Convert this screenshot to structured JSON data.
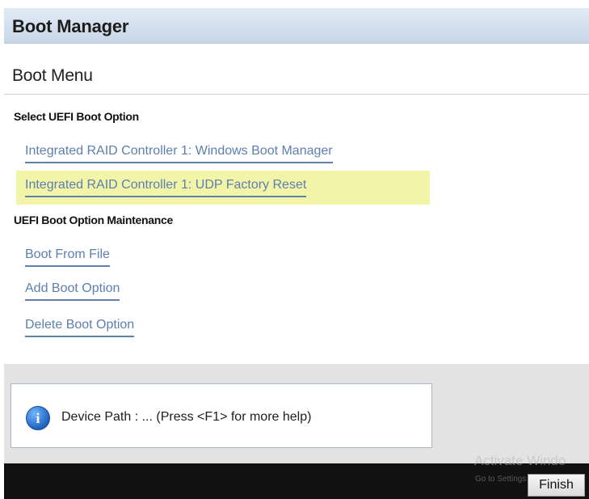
{
  "title": "Boot Manager",
  "boot_menu": {
    "heading": "Boot Menu",
    "uefi_boot": {
      "label": "Select UEFI Boot Option",
      "options": [
        "Integrated RAID Controller 1: Windows Boot Manager",
        "Integrated RAID Controller 1: UDP Factory Reset"
      ],
      "selected": "Integrated RAID Controller 1: UDP Factory Reset"
    },
    "maintenance": {
      "label": "UEFI Boot Option Maintenance",
      "items": [
        "Boot From File",
        "Add Boot Option",
        "Delete Boot Option"
      ]
    }
  },
  "help": {
    "text": "Device Path : ... (Press <F1> for more help)",
    "icon": "info-icon"
  },
  "footer": {
    "finish_label": "Finish",
    "watermark": "Activate Windo",
    "watermark_sub": "Go to Settings to activ"
  },
  "colors": {
    "title_bar": "#c7d6e7",
    "link": "#5c7fb0",
    "selected_highlight": "#f2f5a7",
    "help_area": "#e3e3e3",
    "footer": "#111111"
  }
}
